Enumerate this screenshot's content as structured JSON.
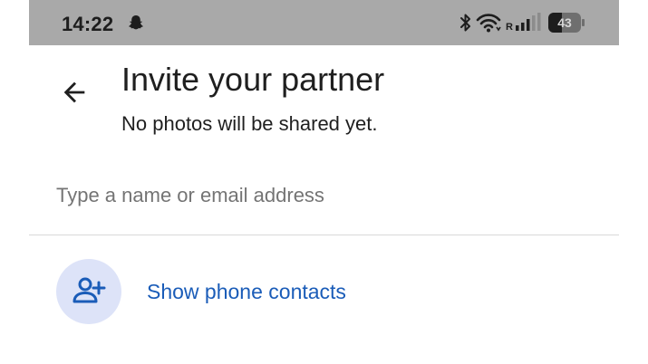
{
  "status_bar": {
    "time": "14:22",
    "battery_level": "43",
    "battery_fraction": 0.43,
    "network_indicator": "R",
    "icons": [
      "snapchat-ghost-icon",
      "bluetooth-icon",
      "wifi-icon",
      "cellular-signal-icon",
      "battery-icon"
    ],
    "background_color": "#a9a9a9"
  },
  "header": {
    "back_icon": "arrow-back-icon",
    "title": "Invite your partner",
    "subtitle": "No photos will be shared yet."
  },
  "search": {
    "value": "",
    "placeholder": "Type a name or email address"
  },
  "contacts": {
    "icon": "person-add-icon",
    "label": "Show phone contacts",
    "accent_color": "#1a5cb8",
    "avatar_color": "#dde3f8"
  }
}
